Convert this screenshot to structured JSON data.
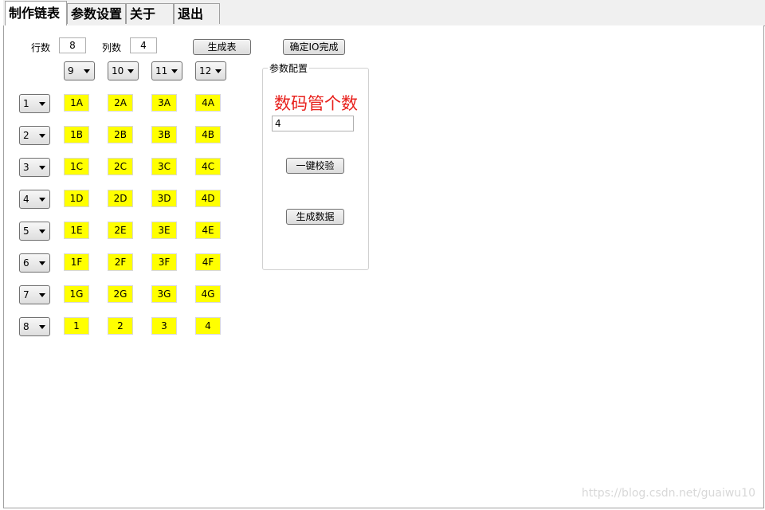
{
  "tabs": [
    {
      "label": "制作链表"
    },
    {
      "label": "参数设置"
    },
    {
      "label": "关于"
    },
    {
      "label": "退出"
    }
  ],
  "form": {
    "rows_label": "行数",
    "rows_value": "8",
    "cols_label": "列数",
    "cols_value": "4",
    "generate_table_label": "生成表",
    "confirm_io_label": "确定IO完成"
  },
  "column_selects": [
    "9",
    "10",
    "11",
    "12"
  ],
  "row_selects": [
    "1",
    "2",
    "3",
    "4",
    "5",
    "6",
    "7",
    "8"
  ],
  "grid": [
    [
      "1A",
      "2A",
      "3A",
      "4A"
    ],
    [
      "1B",
      "2B",
      "3B",
      "4B"
    ],
    [
      "1C",
      "2C",
      "3C",
      "4C"
    ],
    [
      "1D",
      "2D",
      "3D",
      "4D"
    ],
    [
      "1E",
      "2E",
      "3E",
      "4E"
    ],
    [
      "1F",
      "2F",
      "3F",
      "4F"
    ],
    [
      "1G",
      "2G",
      "3G",
      "4G"
    ],
    [
      "1",
      "2",
      "3",
      "4"
    ]
  ],
  "param_group": {
    "title": "参数配置",
    "heading": "数码管个数",
    "count_value": "4",
    "verify_label": "一键校验",
    "generate_data_label": "生成数据"
  },
  "watermark": "https://blog.csdn.net/guaiwu10",
  "colors": {
    "cell_bg": "#ffff00",
    "heading_red": "#e8201c"
  }
}
